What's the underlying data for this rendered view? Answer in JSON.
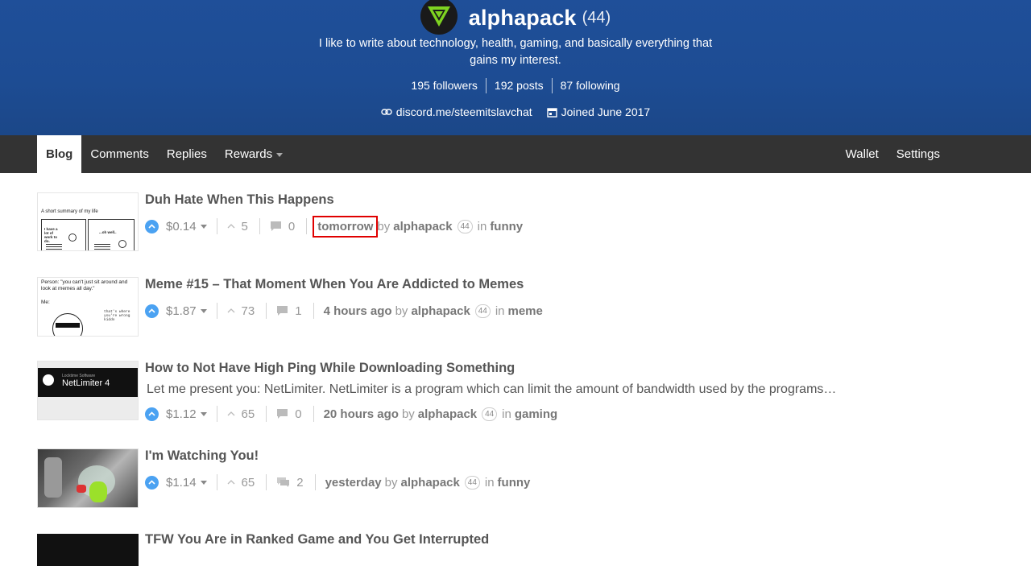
{
  "profile": {
    "username": "alphapack",
    "reputation": "(44)",
    "about": "I like to write about technology, health, gaming, and basically everything that gains my interest.",
    "followers": "195 followers",
    "posts": "192 posts",
    "following": "87 following",
    "website": "discord.me/steemitslavchat",
    "joined": "Joined June 2017",
    "brand_color": "#1f4f99"
  },
  "nav": {
    "blog": "Blog",
    "comments": "Comments",
    "replies": "Replies",
    "rewards": "Rewards",
    "wallet": "Wallet",
    "settings": "Settings"
  },
  "posts": [
    {
      "title": "Duh Hate When This Happens",
      "payout": "$0.14",
      "votes": "5",
      "comments": "0",
      "time": "tomorrow",
      "by": "by",
      "author": "alphapack",
      "rep": "44",
      "in": "in",
      "category": "funny",
      "thumb_text_1": "A short summary of my life",
      "thumb_text_2": "I have a lot of work to do.",
      "thumb_text_3": "...oh well.."
    },
    {
      "title": "Meme #15 – That Moment When You Are Addicted to Memes",
      "payout": "$1.87",
      "votes": "73",
      "comments": "1",
      "time": "4 hours ago",
      "by": "by",
      "author": "alphapack",
      "rep": "44",
      "in": "in",
      "category": "meme",
      "thumb_text_1": "Person: \"you can't just sit around and look at memes all day.\"",
      "thumb_text_2": "Me:",
      "thumb_text_3": "that's where you're wrong kiddo"
    },
    {
      "title": "How to Not Have High Ping While Downloading Something",
      "summary": "Let me present you: NetLimiter. NetLimiter is a program which can limit the amount of bandwidth used by the programs…",
      "payout": "$1.12",
      "votes": "65",
      "comments": "0",
      "time": "20 hours ago",
      "by": "by",
      "author": "alphapack",
      "rep": "44",
      "in": "in",
      "category": "gaming",
      "thumb_text_1": "Locktime Software",
      "thumb_text_2": "NetLimiter 4"
    },
    {
      "title": "I'm Watching You!",
      "payout": "$1.14",
      "votes": "65",
      "comments": "2",
      "time": "yesterday",
      "by": "by",
      "author": "alphapack",
      "rep": "44",
      "in": "in",
      "category": "funny"
    },
    {
      "title": "TFW You Are in Ranked Game and You Get Interrupted"
    }
  ]
}
